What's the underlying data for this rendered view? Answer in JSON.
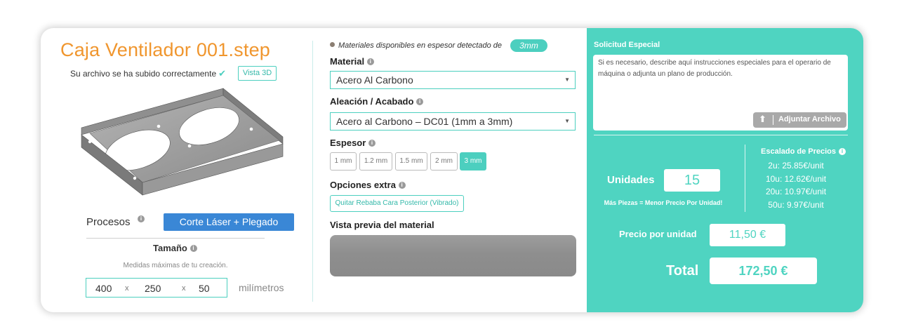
{
  "part": {
    "title": "Caja Ventilador 001.step",
    "upload_message": "Su archivo se ha subido correctamente",
    "view_3d_label": "Vista 3D"
  },
  "process": {
    "label": "Procesos",
    "value": "Corte Láser + Plegado"
  },
  "size": {
    "label": "Tamaño",
    "subtitle": "Medidas máximas de tu creación.",
    "x": "400",
    "y": "250",
    "z": "50",
    "separator": "x",
    "units": "milímetros"
  },
  "materials": {
    "detected_text": "Materiales disponibles en espesor detectado de",
    "detected_thickness": "3mm",
    "material_label": "Material",
    "material_value": "Acero Al Carbono",
    "alloy_label": "Aleación / Acabado",
    "alloy_value": "Acero al Carbono – DC01 (1mm a 3mm)",
    "thickness_label": "Espesor",
    "thickness_options": [
      "1 mm",
      "1.2 mm",
      "1.5 mm",
      "2 mm",
      "3 mm"
    ],
    "thickness_selected": "3 mm",
    "extras_label": "Opciones extra",
    "extras_option": "Quitar Rebaba Cara Posterior (Vibrado)",
    "preview_label": "Vista previa del material"
  },
  "special_request": {
    "label": "Solicitud Especial",
    "placeholder": "Si es necesario, describe aquí instrucciones especiales para el operario de máquina o adjunta un plano de producción.",
    "attach_label": "Adjuntar Archivo"
  },
  "pricing": {
    "units_label": "Unidades",
    "units_value": "15",
    "more_pieces_text": "Más Piezas = Menor Precio Por Unidad!",
    "tiers_title": "Escalado de Precios",
    "tiers": [
      "2u: 25.85€/unit",
      "10u: 12.62€/unit",
      "20u: 10.97€/unit",
      "50u: 9.97€/unit"
    ],
    "unit_price_label": "Precio por unidad",
    "unit_price_value": "11,50 €",
    "total_label": "Total",
    "total_value": "172,50 €"
  },
  "colors": {
    "accent": "#4fd4c1",
    "title_orange": "#f0962e",
    "process_blue": "#3a87d6"
  }
}
